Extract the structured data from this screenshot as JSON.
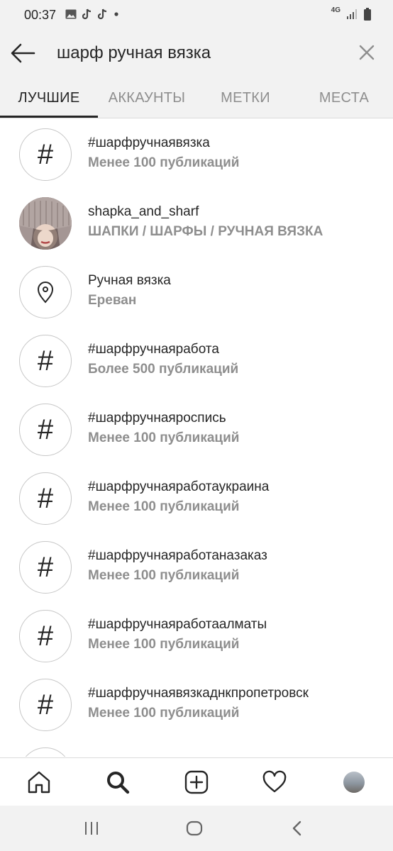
{
  "status": {
    "time": "00:37",
    "network": "4G"
  },
  "search": {
    "query": "шарф ручная вязка"
  },
  "tabs": [
    {
      "label": "ЛУЧШИЕ",
      "active": true
    },
    {
      "label": "АККАУНТЫ",
      "active": false
    },
    {
      "label": "МЕТКИ",
      "active": false
    },
    {
      "label": "МЕСТА",
      "active": false
    }
  ],
  "results": [
    {
      "icon": "hashtag-icon",
      "title": "#шарфручнаявязка",
      "subtitle": "Менее 100 публикаций"
    },
    {
      "icon": "profile-photo",
      "title": "shapka_and_sharf",
      "subtitle": "ШАПКИ / ШАРФЫ / РУЧНАЯ ВЯЗКА"
    },
    {
      "icon": "location-pin-icon",
      "title": "Ручная вязка",
      "subtitle": "Ереван"
    },
    {
      "icon": "hashtag-icon",
      "title": "#шарфручнаяработа",
      "subtitle": "Более 500 публикаций"
    },
    {
      "icon": "hashtag-icon",
      "title": "#шарфручнаяроспись",
      "subtitle": "Менее 100 публикаций"
    },
    {
      "icon": "hashtag-icon",
      "title": "#шарфручнаяработаукраина",
      "subtitle": "Менее 100 публикаций"
    },
    {
      "icon": "hashtag-icon",
      "title": "#шарфручнаяработаназаказ",
      "subtitle": "Менее 100 публикаций"
    },
    {
      "icon": "hashtag-icon",
      "title": "#шарфручнаяработаалматы",
      "subtitle": "Менее 100 публикаций"
    },
    {
      "icon": "hashtag-icon",
      "title": "#шарфручнаявязкаднкпропетровск",
      "subtitle": "Менее 100 публикаций"
    }
  ],
  "colors": {
    "primary_text": "#262626",
    "secondary_text": "#8e8e8e",
    "bar_bg": "#f2f2f2"
  }
}
